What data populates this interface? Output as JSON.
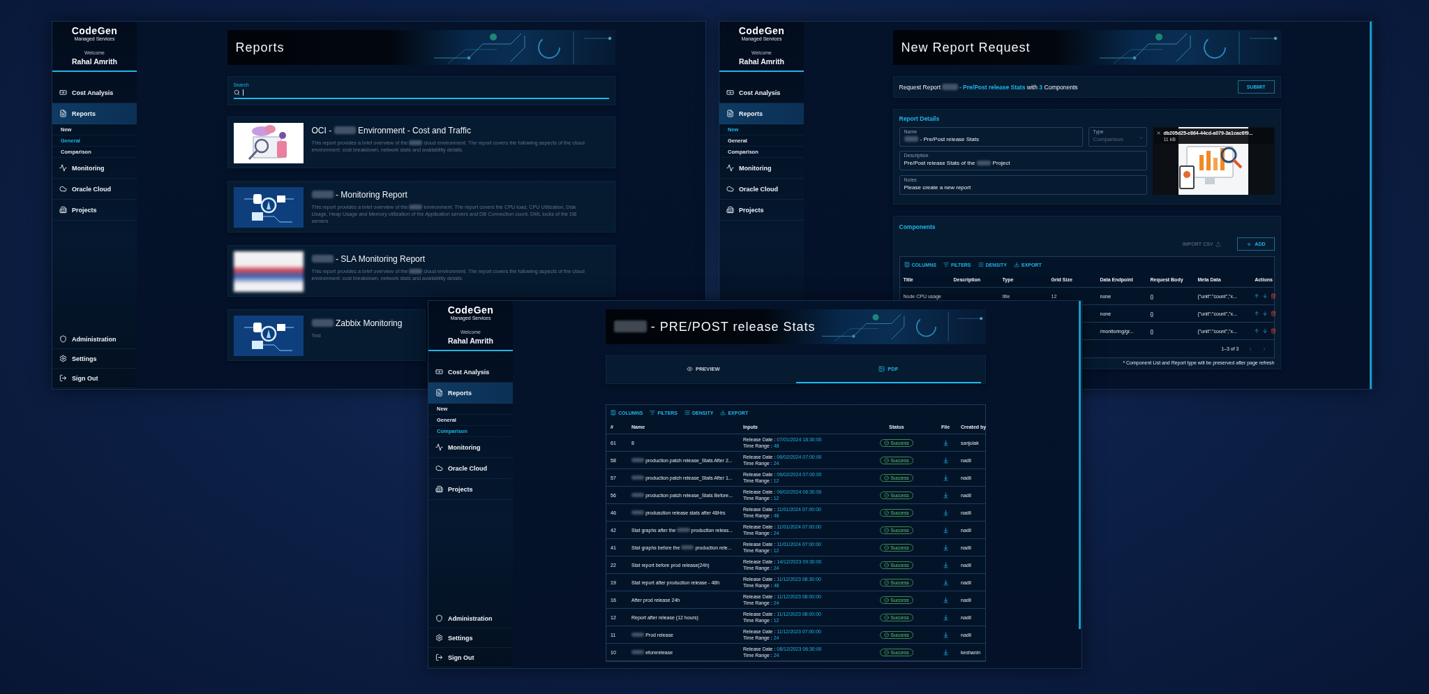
{
  "left_window": {
    "sidebar": {
      "logo": "CodeGen",
      "logo_subtitle": "Managed Services",
      "welcome": "Welcome",
      "user": "Rahal Amrith",
      "items": [
        {
          "label": "Cost Analysis",
          "selected": false
        },
        {
          "label": "Reports",
          "selected": true,
          "children": [
            {
              "label": "New",
              "selected": false
            },
            {
              "label": "General",
              "selected": true
            },
            {
              "label": "Comparison",
              "selected": false
            }
          ]
        },
        {
          "label": "Monitoring",
          "selected": false
        },
        {
          "label": "Oracle Cloud",
          "selected": false
        },
        {
          "label": "Projects",
          "selected": false
        }
      ],
      "footer_items": [
        {
          "label": "Administration"
        },
        {
          "label": "Settings"
        },
        {
          "label": "Sign Out"
        }
      ]
    },
    "page": {
      "title": [
        "Reports"
      ],
      "search": {
        "label": "Search"
      },
      "reports": [
        {
          "kind": "people",
          "title": [
            "OCI -",
            {
              "kind": "redacted"
            },
            "Environment - Cost and Traffic"
          ],
          "description": [
            "This report provides a brief overview of the",
            {
              "kind": "redacted"
            },
            "cloud environment. The report covers the following aspects of the cloud environment: cost breakdown, network stats and availability details."
          ]
        },
        {
          "kind": "monitoring",
          "title": [
            {
              "kind": "redacted"
            },
            "- Monitoring Report"
          ],
          "description": [
            "This report provides a brief overview of the",
            {
              "kind": "redacted"
            },
            "environment. The report covers the CPU load, CPU Utilization, Disk Usage, Heap Usage and Memory utilization of the Application servers and DB Connection count, DML locks of the DB servers"
          ]
        },
        {
          "kind": "blurred",
          "title": [
            {
              "kind": "redacted"
            },
            "- SLA Monitoring Report"
          ],
          "description": [
            "This report provides a brief overview of the",
            {
              "kind": "redacted"
            },
            "cloud environment. The report covers the following aspects of the cloud environment: cost breakdown, network stats and availability details."
          ]
        },
        {
          "kind": "monitoring",
          "title": [
            {
              "kind": "redacted"
            },
            "Zabbix Monitoring"
          ],
          "description": [
            "Test"
          ]
        }
      ]
    }
  },
  "right_window": {
    "sidebar": {
      "logo": "CodeGen",
      "logo_subtitle": "Managed Services",
      "welcome": "Welcome",
      "user": "Rahal Amrith",
      "items": [
        {
          "label": "Cost Analysis",
          "selected": false
        },
        {
          "label": "Reports",
          "selected": true,
          "children": [
            {
              "label": "New",
              "selected": true
            },
            {
              "label": "General",
              "selected": false
            },
            {
              "label": "Comparison",
              "selected": false
            }
          ]
        },
        {
          "label": "Monitoring",
          "selected": false
        },
        {
          "label": "Oracle Cloud",
          "selected": false
        },
        {
          "label": "Projects",
          "selected": false
        }
      ]
    },
    "page": {
      "title": [
        "New Report Request"
      ],
      "request": {
        "text": [
          "Request Report",
          {
            "kind": "redacted"
          },
          {
            "kind": "accent",
            "text": "- Pre/Post release Stats"
          },
          "with",
          {
            "kind": "accent",
            "text": "3"
          },
          "Components"
        ],
        "submit": "SUBMIT"
      },
      "details": {
        "heading": "Report Details",
        "fields": [
          {
            "kind": "text",
            "label": "Name",
            "value": [
              {
                "kind": "redacted"
              },
              "- Pre/Post release Stats"
            ]
          },
          {
            "kind": "select",
            "label": "Type",
            "value": [
              "Comparison"
            ],
            "disabled": true
          },
          {
            "kind": "text",
            "label": "Description",
            "value": [
              "Pre/Post release Stats of the",
              {
                "kind": "redacted"
              },
              "Project"
            ]
          },
          {
            "kind": "text",
            "label": "Notes",
            "value": [
              "Please create a new report"
            ]
          }
        ],
        "attachment": {
          "file_name": "db205d25-e864-44cd-a079-3a1cac6f9...",
          "file_size": "11 kB"
        }
      },
      "components": {
        "heading": "Components",
        "import_label": "IMPORT CSV",
        "import_disabled": true,
        "add_label": "ADD",
        "toolbar": [
          "COLUMNS",
          "FILTERS",
          "DENSITY",
          "EXPORT"
        ],
        "columns": [
          "Title",
          "Description",
          "Type",
          "Grid Size",
          "Data Endpoint",
          "Request Body",
          "Meta Data",
          "Actions"
        ],
        "rows": [
          {
            "title": "Node CPU usage",
            "type": "title",
            "grid_size": "12",
            "endpoint": "none",
            "request_body": "{}",
            "meta": "{\"unit\":\"count\",\"x..."
          },
          {
            "endpoint": "none",
            "request_body": "{}",
            "meta": "{\"unit\":\"count\",\"x..."
          },
          {
            "endpoint": "/monitoring/gr...",
            "request_body": "{}",
            "meta": "{\"unit\":\"count\",\"x..."
          }
        ],
        "pagination": "1–3 of 3",
        "note": "* Component List and Report type will be preserved after page refresh"
      }
    }
  },
  "front_window": {
    "sidebar": {
      "logo": "CodeGen",
      "logo_subtitle": "Managed Services",
      "welcome": "Welcome",
      "user": "Rahal Amrith",
      "items": [
        {
          "label": "Cost Analysis",
          "selected": false
        },
        {
          "label": "Reports",
          "selected": true,
          "children": [
            {
              "label": "New",
              "selected": false
            },
            {
              "label": "General",
              "selected": false
            },
            {
              "label": "Comparison",
              "selected": true
            }
          ]
        },
        {
          "label": "Monitoring",
          "selected": false
        },
        {
          "label": "Oracle Cloud",
          "selected": false
        },
        {
          "label": "Projects",
          "selected": false
        }
      ],
      "footer_items": [
        {
          "label": "Administration"
        },
        {
          "label": "Settings"
        },
        {
          "label": "Sign Out"
        }
      ]
    },
    "page": {
      "title": [
        {
          "kind": "redacted"
        },
        "- PRE/POST release Stats"
      ],
      "tabs": [
        {
          "label": "PREVIEW",
          "selected": false
        },
        {
          "label": "PDF",
          "selected": true
        }
      ],
      "table": {
        "toolbar": [
          "COLUMNS",
          "FILTERS",
          "DENSITY",
          "EXPORT"
        ],
        "columns": [
          "#",
          "Name",
          "Inputs",
          "Status",
          "File",
          "Created by"
        ],
        "rows": [
          {
            "id": "61",
            "name": [
              "8"
            ],
            "date_label": "Release Date :",
            "date": "07/01/2024 18:30:00",
            "range_label": "Time Range :",
            "range": "48",
            "status": "Success",
            "created_by": "sanjulak"
          },
          {
            "id": "58",
            "name": [
              {
                "kind": "redacted"
              },
              "production patch release_Stats After 2..."
            ],
            "date_label": "Release Date :",
            "date": "06/02/2024 07:00:00",
            "range_label": "Time Range :",
            "range": "24",
            "status": "Success",
            "created_by": "nadil"
          },
          {
            "id": "57",
            "name": [
              {
                "kind": "redacted"
              },
              "production patch release_Stats After 1..."
            ],
            "date_label": "Release Date :",
            "date": "06/02/2024 07:00:00",
            "range_label": "Time Range :",
            "range": "12",
            "status": "Success",
            "created_by": "nadil"
          },
          {
            "id": "56",
            "name": [
              {
                "kind": "redacted"
              },
              "production patch release_Stats Before..."
            ],
            "date_label": "Release Date :",
            "date": "06/02/2024 06:30:00",
            "range_label": "Time Range :",
            "range": "12",
            "status": "Success",
            "created_by": "nadil"
          },
          {
            "id": "46",
            "name": [
              {
                "kind": "redacted"
              },
              "produsction release stats after 48Hrs"
            ],
            "date_label": "Release Date :",
            "date": "11/01/2024 07:00:00",
            "range_label": "Time Range :",
            "range": "48",
            "status": "Success",
            "created_by": "nadil"
          },
          {
            "id": "42",
            "name": [
              "Stat graphs after the",
              {
                "kind": "redacted"
              },
              "production releas..."
            ],
            "date_label": "Release Date :",
            "date": "11/01/2024 07:00:00",
            "range_label": "Time Range :",
            "range": "24",
            "status": "Success",
            "created_by": "nadil"
          },
          {
            "id": "41",
            "name": [
              "Stat graphs before the",
              {
                "kind": "redacted"
              },
              "production rele..."
            ],
            "date_label": "Release Date :",
            "date": "11/01/2024 07:00:00",
            "range_label": "Time Range :",
            "range": "12",
            "status": "Success",
            "created_by": "nadil"
          },
          {
            "id": "22",
            "name": [
              "Stat report before prod release(24h)"
            ],
            "date_label": "Release Date :",
            "date": "14/12/2023 09:30:00",
            "range_label": "Time Range :",
            "range": "24",
            "status": "Success",
            "created_by": "nadil"
          },
          {
            "id": "19",
            "name": [
              "Stat report after production release - 48h"
            ],
            "date_label": "Release Date :",
            "date": "11/12/2023 08:30:00",
            "range_label": "Time Range :",
            "range": "48",
            "status": "Success",
            "created_by": "nadil"
          },
          {
            "id": "16",
            "name": [
              "After prod release 24h"
            ],
            "date_label": "Release Date :",
            "date": "11/12/2023 08:00:00",
            "range_label": "Time Range :",
            "range": "24",
            "status": "Success",
            "created_by": "nadil"
          },
          {
            "id": "12",
            "name": [
              "Report after release (12 hours)"
            ],
            "date_label": "Release Date :",
            "date": "11/12/2023 08:00:00",
            "range_label": "Time Range :",
            "range": "12",
            "status": "Success",
            "created_by": "nadil"
          },
          {
            "id": "11",
            "name": [
              {
                "kind": "redacted"
              },
              "Prod release"
            ],
            "date_label": "Release Date :",
            "date": "11/12/2023 07:00:00",
            "range_label": "Time Range :",
            "range": "24",
            "status": "Success",
            "created_by": "nadil"
          },
          {
            "id": "10",
            "name": [
              {
                "kind": "redacted"
              },
              "eforerelease"
            ],
            "date_label": "Release Date :",
            "date": "08/12/2023 06:30:00",
            "range_label": "Time Range :",
            "range": "24",
            "status": "Success",
            "created_by": "keshanin"
          }
        ]
      }
    }
  }
}
